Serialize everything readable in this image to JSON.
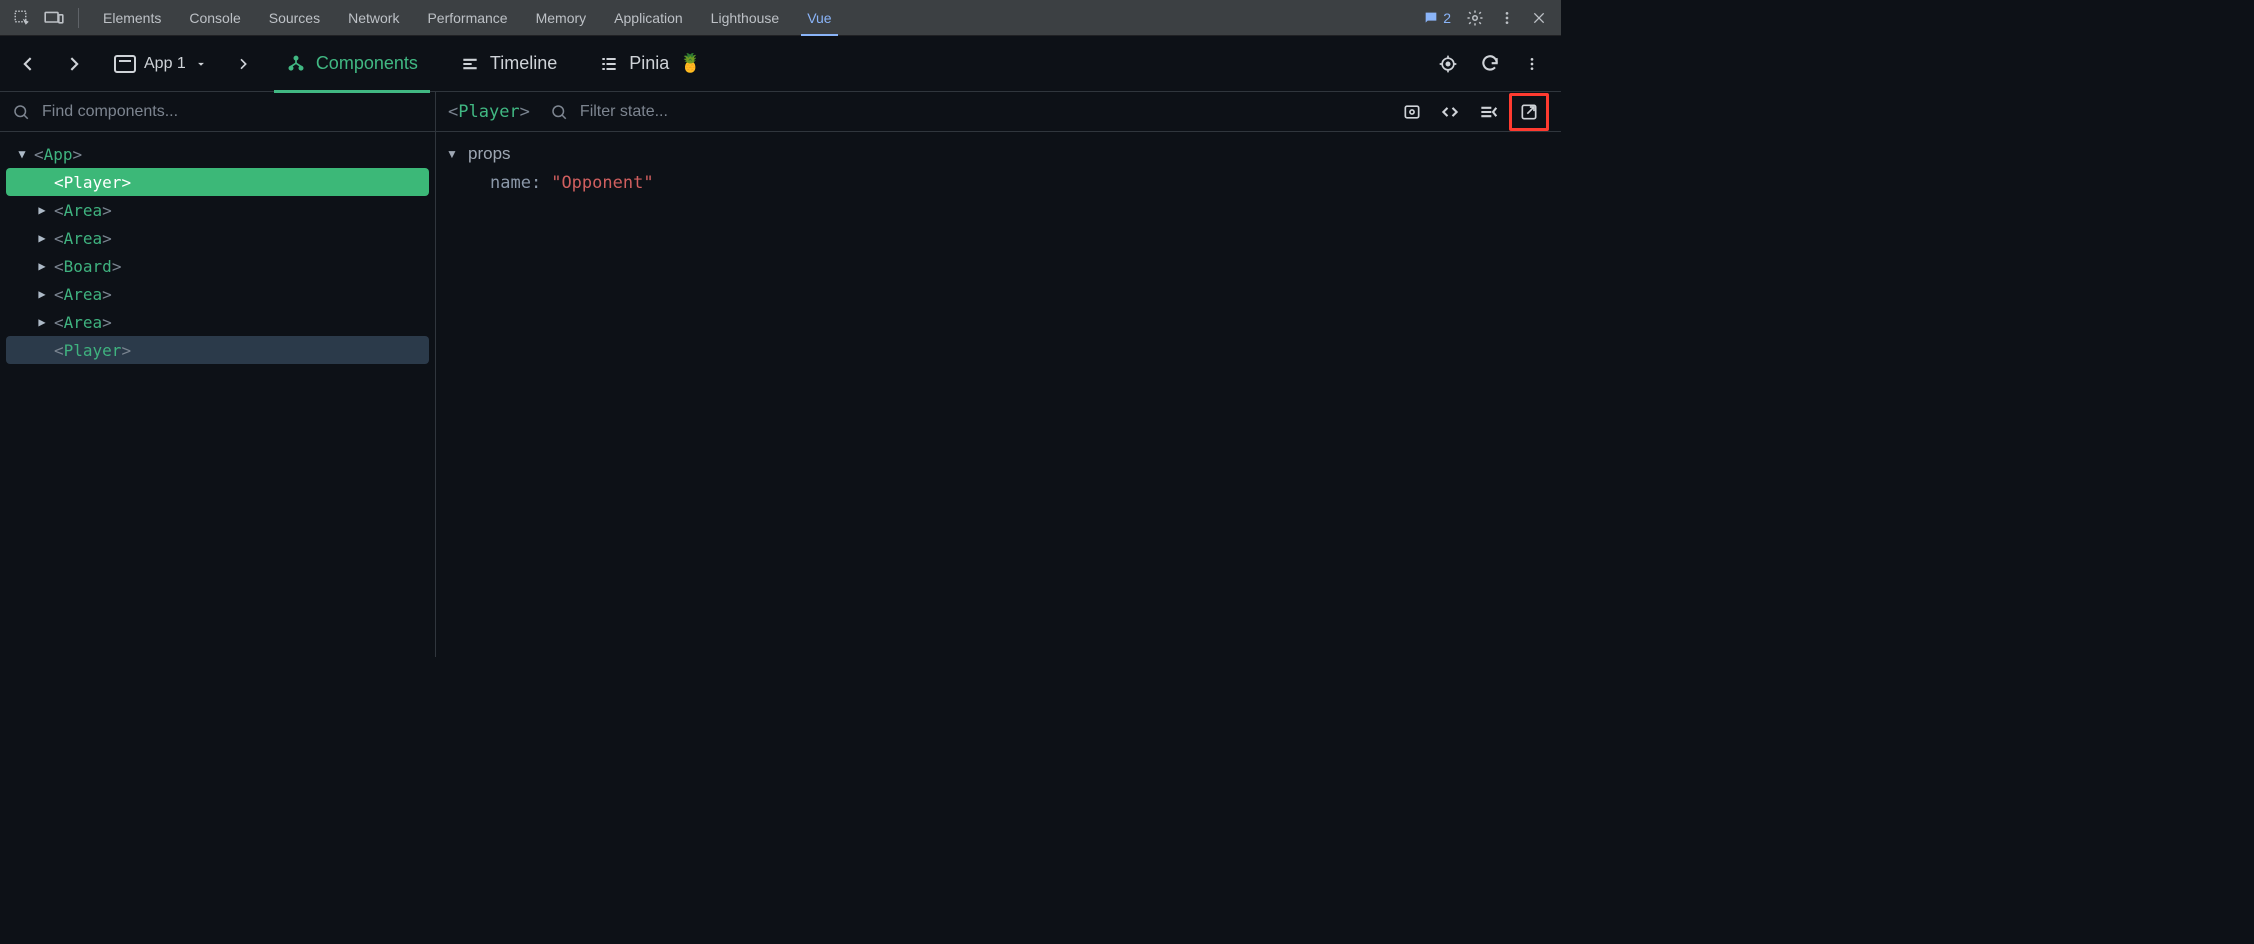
{
  "devtools": {
    "tabs": [
      "Elements",
      "Console",
      "Sources",
      "Network",
      "Performance",
      "Memory",
      "Application",
      "Lighthouse",
      "Vue"
    ],
    "activeIndex": 8,
    "messageCount": "2"
  },
  "vuebar": {
    "appLabel": "App 1",
    "tabs": {
      "components": "Components",
      "timeline": "Timeline",
      "pinia": "Pinia"
    },
    "activeTab": "components"
  },
  "search": {
    "componentsPlaceholder": "Find components...",
    "statePlaceholder": "Filter state...",
    "selectedComponent": "Player"
  },
  "tree": [
    {
      "name": "App",
      "indent": 0,
      "expandable": true,
      "open": true,
      "state": ""
    },
    {
      "name": "Player",
      "indent": 1,
      "expandable": false,
      "open": false,
      "state": "selected"
    },
    {
      "name": "Area",
      "indent": 1,
      "expandable": true,
      "open": false,
      "state": ""
    },
    {
      "name": "Area",
      "indent": 1,
      "expandable": true,
      "open": false,
      "state": ""
    },
    {
      "name": "Board",
      "indent": 1,
      "expandable": true,
      "open": false,
      "state": ""
    },
    {
      "name": "Area",
      "indent": 1,
      "expandable": true,
      "open": false,
      "state": ""
    },
    {
      "name": "Area",
      "indent": 1,
      "expandable": true,
      "open": false,
      "state": ""
    },
    {
      "name": "Player",
      "indent": 1,
      "expandable": false,
      "open": false,
      "state": "hover"
    }
  ],
  "state": {
    "groupLabel": "props",
    "props": [
      {
        "key": "name",
        "value": "\"Opponent\""
      }
    ]
  }
}
